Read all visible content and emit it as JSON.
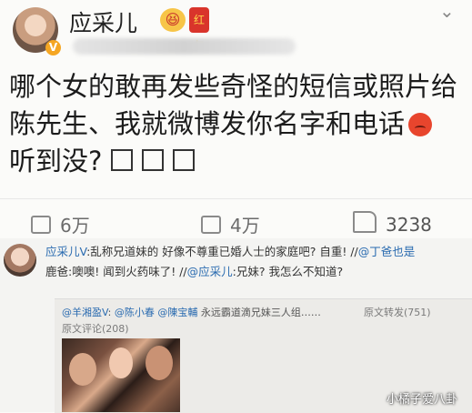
{
  "header": {
    "poster_name": "应采儿",
    "emoji1": "😆",
    "emoji2": "红包",
    "verified_mark": "V"
  },
  "post": {
    "line1": "哪个女的敢再发些奇怪的短信或照片给",
    "line2": "陈先生、我就微博发你名字和电话",
    "line3": "听到没?"
  },
  "actions": {
    "repost_count": "6万",
    "comment_count": "4万",
    "like_count": "3238"
  },
  "retweet": {
    "author": "应采儿",
    "text_a": ":乱称兄道妹的 好像不尊重已婚人士的家庭吧? 自重! //",
    "mention1": "@丁爸也是",
    "text_b": "鹿爸",
    "text_c": ":噢噢! 闻到火药味了! //",
    "mention2": "@应采儿",
    "text_d": ":兄妹? 我怎么不知道?"
  },
  "quoted": {
    "author": "@羊湘盈V",
    "mention1": "@陈小春",
    "mention2": "@陳宝輔",
    "text": "永远霸道滴兄妹三人组……",
    "origin": "原文转发(751)",
    "comments": "原文评论(208)"
  },
  "watermark": "小橘子爱八卦",
  "colors": {
    "link": "#2a6bb0",
    "verified": "#f5a623"
  }
}
